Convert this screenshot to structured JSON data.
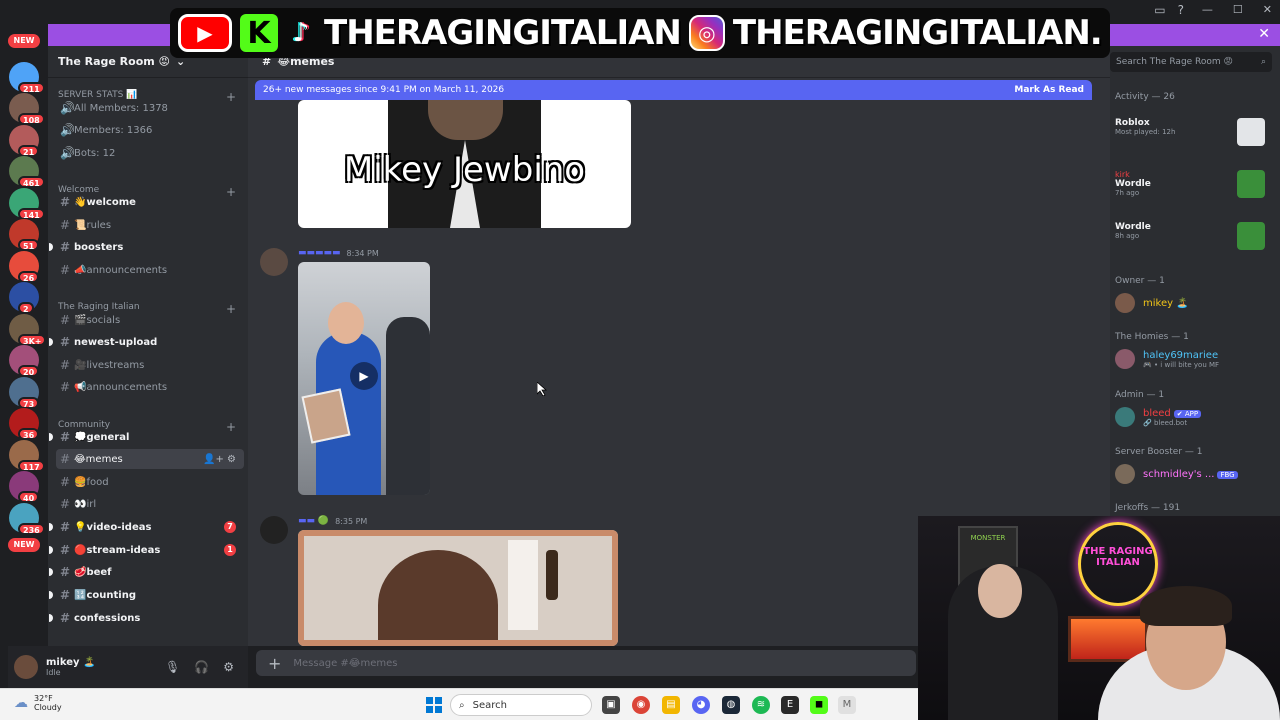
{
  "window": {
    "notice_close": "✕"
  },
  "banner": {
    "k_letter": "K",
    "tiktok_handle": "THERAGINGITALIAN",
    "instagram_handle": "THERAGINGITALIAN."
  },
  "rail": {
    "badges": [
      {
        "label": "NEW",
        "type": "new"
      },
      {
        "label": "211"
      },
      {
        "label": "108"
      },
      {
        "label": "21"
      },
      {
        "label": "461"
      },
      {
        "label": "141"
      },
      {
        "label": "51"
      },
      {
        "label": "26"
      },
      {
        "label": "2"
      },
      {
        "label": "3K+"
      },
      {
        "label": "20"
      },
      {
        "label": "73"
      },
      {
        "label": "36"
      },
      {
        "label": "117"
      },
      {
        "label": "40"
      },
      {
        "label": "236"
      },
      {
        "label": "NEW",
        "type": "new"
      }
    ]
  },
  "server": {
    "name": "The Rage Room 😡"
  },
  "sidebar": {
    "server_stats": "SERVER STATS 📊",
    "stats": [
      {
        "label": "All Members: 1378"
      },
      {
        "label": "Members: 1366"
      },
      {
        "label": "Bots: 12"
      }
    ],
    "categories": {
      "welcome": "Welcome",
      "raging_italian": "The Raging Italian",
      "community": "Community"
    },
    "channels": [
      {
        "label": "👋welcome",
        "bold": true
      },
      {
        "label": "📜rules"
      },
      {
        "label": "boosters",
        "bold": true,
        "unread": true
      },
      {
        "label": "📣announcements"
      },
      {
        "label": "🎬socials"
      },
      {
        "label": "newest-upload",
        "bold": true,
        "unread": true
      },
      {
        "label": "🎥livestreams"
      },
      {
        "label": "📢announcements"
      },
      {
        "label": "💭general",
        "bold": true,
        "unread": true
      },
      {
        "label": "😂memes",
        "active": true
      },
      {
        "label": "🍔food"
      },
      {
        "label": "👀irl"
      },
      {
        "label": "💡video-ideas",
        "bold": true,
        "unread": true,
        "badge": "7"
      },
      {
        "label": "🔴stream-ideas",
        "bold": true,
        "unread": true,
        "badge": "1"
      },
      {
        "label": "🥩beef",
        "bold": true,
        "unread": true
      },
      {
        "label": "🔢counting",
        "bold": true,
        "unread": true
      },
      {
        "label": "confessions",
        "bold": true,
        "unread": true
      }
    ]
  },
  "user": {
    "name": "mikey 🏝️",
    "status": "Idle"
  },
  "chat": {
    "channel": "😂memes",
    "new_messages": "26+ new messages since 9:41 PM on March 11, 2026",
    "mark_as_read": "Mark As Read",
    "meme1_caption": "Mikey Jewbino",
    "msg2_time": "8:34 PM",
    "msg3_time": "8:35 PM",
    "composer_placeholder": "Message #😂memes"
  },
  "members": {
    "search_placeholder": "Search The Rage Room 😡",
    "activity_header": "Activity — 26",
    "activities": [
      {
        "game": "Roblox",
        "sub": "Most played: 12h",
        "user": "",
        "color": "#e3e5e8"
      },
      {
        "game": "Wordle",
        "sub": "7h ago",
        "user": "kirk",
        "color": "#3a8f3a"
      },
      {
        "game": "Wordle",
        "sub": "8h ago",
        "user": "",
        "color": "#3a8f3a"
      }
    ],
    "groups": [
      {
        "header": "Owner — 1",
        "name": "mikey 🏝️",
        "sub": "",
        "color": "#f0c419",
        "tag": ""
      },
      {
        "header": "The Homies — 1",
        "name": "haley69mariee",
        "sub": "🎮 • i will bite you MF",
        "color": "#4fc3f7",
        "tag": ""
      },
      {
        "header": "Admin — 1",
        "name": "bleed",
        "sub": "🔗 bleed.bot",
        "color": "#f23f43",
        "tag": "✔ APP"
      },
      {
        "header": "Server Booster — 1",
        "name": "schmidley's ...",
        "sub": "",
        "color": "#ff73fa",
        "tag": "FBG"
      }
    ],
    "bottom_header": "Jerkoffs — 191"
  },
  "webcam": {
    "neon_text": "THE RAGING ITALIAN",
    "fridge_text": "MONSTER"
  },
  "taskbar": {
    "temperature": "32°F",
    "condition": "Cloudy",
    "search": "Search"
  }
}
